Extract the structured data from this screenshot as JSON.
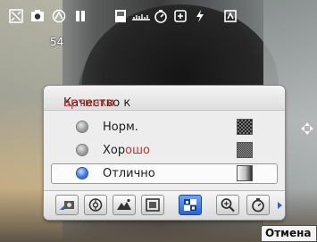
{
  "status": {
    "shots_remaining": "54",
    "icons": [
      "exposure-icon",
      "camera-mode-icon",
      "wb-auto-icon",
      "battery-icon",
      "storage-icon",
      "audio-icon",
      "timer-icon",
      "stabilizer-icon",
      "flash-icon",
      "macro-icon"
    ]
  },
  "panel": {
    "title_prefix": "Качество к",
    "title_accent": "артинки",
    "options": [
      {
        "label": "Норм.",
        "accent": "",
        "selected": false,
        "preview": "norm"
      },
      {
        "label": "Хор",
        "accent": "ошо",
        "selected": false,
        "preview": "good"
      },
      {
        "label": "Отлично",
        "accent": "",
        "selected": true,
        "preview": "excellent"
      }
    ],
    "toolbar": [
      "scene-icon",
      "focus-icon",
      "landscape-icon",
      "frame-icon",
      "quality-icon",
      "zoom-icon",
      "timer-icon"
    ],
    "active_tool": 4
  },
  "softkey": {
    "cancel_label": "Отмена"
  },
  "colors": {
    "accent_red": "#c9312c",
    "selection_blue": "#2764d4"
  }
}
